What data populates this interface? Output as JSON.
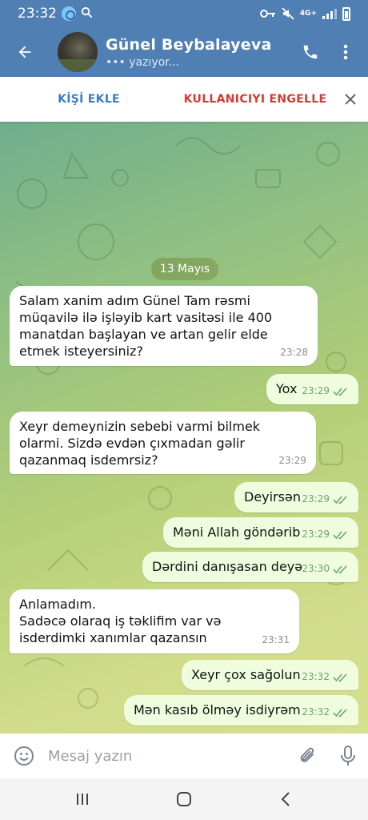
{
  "status_bar": {
    "time": "23:32",
    "network": "4G+"
  },
  "header": {
    "name": "Günel Beybalayeva",
    "status": "••• yazıyor..."
  },
  "action_bar": {
    "add_contact": "KİŞİ EKLE",
    "block_user": "KULLANICIYI ENGELLE"
  },
  "chat": {
    "date": "13 Mayıs",
    "messages": [
      {
        "direction": "in",
        "text": "Salam xanim adım Günel Tam rəsmi müqavilə ilə işləyib kart vasitəsi ile 400 manatdan başlayan ve artan gelir elde etmek isteyersiniz?",
        "time": "23:28"
      },
      {
        "direction": "out",
        "text": "Yox",
        "time": "23:29"
      },
      {
        "direction": "in",
        "text": "Xeyr demeynizin sebebi varmi bilmek olarmi. Sizdə evdən çıxmadan gəlir qazanmaq isdemrsiz?",
        "time": "23:29"
      },
      {
        "direction": "out",
        "text": "Deyirsən",
        "time": "23:29"
      },
      {
        "direction": "out",
        "text": "Məni Allah göndərib",
        "time": "23:29"
      },
      {
        "direction": "out",
        "text": "Dərdini danışasan deyə",
        "time": "23:30"
      },
      {
        "direction": "in",
        "text": "Anlamadım.\nSadəcə olaraq iş təklifim var və isderdimki xanımlar qazansın",
        "time": "23:31"
      },
      {
        "direction": "out",
        "text": "Xeyr çox sağolun",
        "time": "23:32"
      },
      {
        "direction": "out",
        "text": "Mən kasıb ölməy isdiyrəm",
        "time": "23:32"
      }
    ]
  },
  "composer": {
    "placeholder": "Mesaj yazın"
  },
  "colors": {
    "header": "#4f7fb3",
    "accent": "#3a7bc8",
    "danger": "#d33a32",
    "outgoing_bubble": "#effdde",
    "read_check": "#6aa66e"
  },
  "icons": [
    "back-arrow-icon",
    "phone-icon",
    "more-vert-icon",
    "close-icon",
    "read-check-icon",
    "emoji-icon",
    "attach-icon",
    "mic-icon",
    "recents-icon",
    "home-icon",
    "nav-back-icon"
  ]
}
